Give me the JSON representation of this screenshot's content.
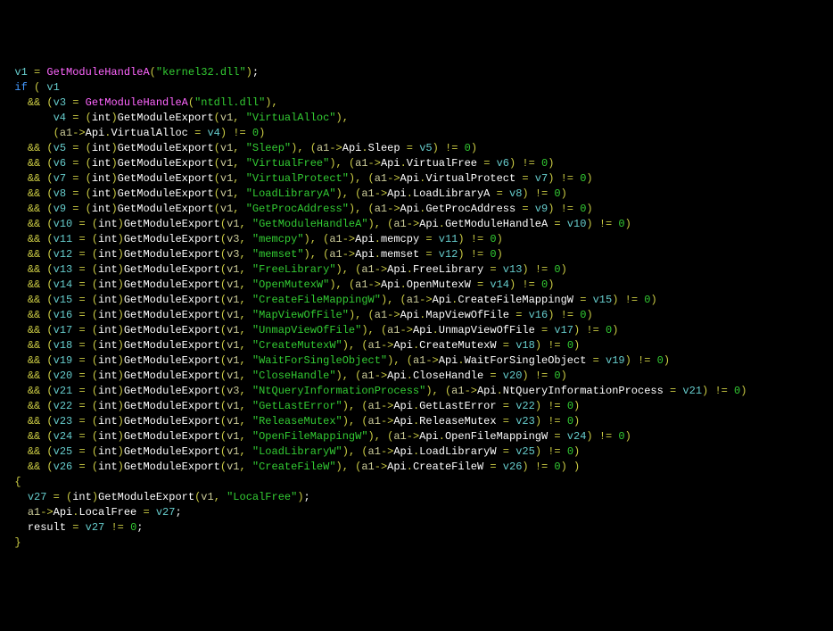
{
  "lines": {
    "l1_v": "v1",
    "l1_fn": "GetModuleHandleA",
    "l1_str": "\"kernel32.dll\"",
    "if_kw": "if",
    "cond_v1": "v1",
    "l3_v": "v3",
    "l3_fn": "GetModuleHandleA",
    "l3_str": "\"ntdll.dll\"",
    "l4_v": "v4",
    "gme": "GetModuleExport",
    "int_cast": "int",
    "arg_v1": "v1",
    "arg_v3": "v3",
    "api": "Api",
    "a1": "a1",
    "zero": "0",
    "row4_str": "\"VirtualAlloc\"",
    "row4_api": "VirtualAlloc",
    "row4_rv": "v4",
    "rows": [
      {
        "v": "v5",
        "src": "v1",
        "str": "\"Sleep\"",
        "api": "Sleep"
      },
      {
        "v": "v6",
        "src": "v1",
        "str": "\"VirtualFree\"",
        "api": "VirtualFree"
      },
      {
        "v": "v7",
        "src": "v1",
        "str": "\"VirtualProtect\"",
        "api": "VirtualProtect"
      },
      {
        "v": "v8",
        "src": "v1",
        "str": "\"LoadLibraryA\"",
        "api": "LoadLibraryA"
      },
      {
        "v": "v9",
        "src": "v1",
        "str": "\"GetProcAddress\"",
        "api": "GetProcAddress"
      },
      {
        "v": "v10",
        "src": "v1",
        "str": "\"GetModuleHandleA\"",
        "api": "GetModuleHandleA"
      },
      {
        "v": "v11",
        "src": "v3",
        "str": "\"memcpy\"",
        "api": "memcpy"
      },
      {
        "v": "v12",
        "src": "v3",
        "str": "\"memset\"",
        "api": "memset"
      },
      {
        "v": "v13",
        "src": "v1",
        "str": "\"FreeLibrary\"",
        "api": "FreeLibrary"
      },
      {
        "v": "v14",
        "src": "v1",
        "str": "\"OpenMutexW\"",
        "api": "OpenMutexW"
      },
      {
        "v": "v15",
        "src": "v1",
        "str": "\"CreateFileMappingW\"",
        "api": "CreateFileMappingW"
      },
      {
        "v": "v16",
        "src": "v1",
        "str": "\"MapViewOfFile\"",
        "api": "MapViewOfFile"
      },
      {
        "v": "v17",
        "src": "v1",
        "str": "\"UnmapViewOfFile\"",
        "api": "UnmapViewOfFile"
      },
      {
        "v": "v18",
        "src": "v1",
        "str": "\"CreateMutexW\"",
        "api": "CreateMutexW"
      },
      {
        "v": "v19",
        "src": "v1",
        "str": "\"WaitForSingleObject\"",
        "api": "WaitForSingleObject"
      },
      {
        "v": "v20",
        "src": "v1",
        "str": "\"CloseHandle\"",
        "api": "CloseHandle"
      },
      {
        "v": "v21",
        "src": "v3",
        "str": "\"NtQueryInformationProcess\"",
        "api": "NtQueryInformationProcess"
      },
      {
        "v": "v22",
        "src": "v1",
        "str": "\"GetLastError\"",
        "api": "GetLastError"
      },
      {
        "v": "v23",
        "src": "v1",
        "str": "\"ReleaseMutex\"",
        "api": "ReleaseMutex"
      },
      {
        "v": "v24",
        "src": "v1",
        "str": "\"OpenFileMappingW\"",
        "api": "OpenFileMappingW"
      },
      {
        "v": "v25",
        "src": "v1",
        "str": "\"LoadLibraryW\"",
        "api": "LoadLibraryW"
      },
      {
        "v": "v26",
        "src": "v1",
        "str": "\"CreateFileW\"",
        "api": "CreateFileW"
      }
    ],
    "body_v27": "v27",
    "body_str": "\"LocalFree\"",
    "body_api": "LocalFree",
    "result": "result"
  }
}
